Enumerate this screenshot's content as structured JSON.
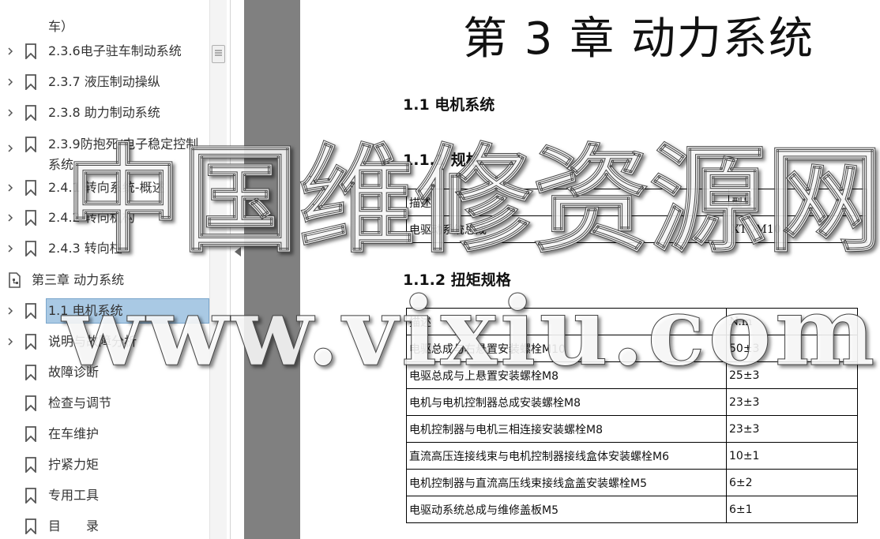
{
  "sidebar": {
    "items": [
      {
        "label": "车）",
        "kind": "partial"
      },
      {
        "label": "2.3.6电子驻车制动系统"
      },
      {
        "label": "2.3.7 液压制动操纵"
      },
      {
        "label": "2.3.8 助力制动系统"
      },
      {
        "label": "2.3.9防抱死/电子稳定控制系统"
      },
      {
        "label": "2.4.1 转向系统-概述"
      },
      {
        "label": "2.4.2 转向机构"
      },
      {
        "label": "2.4.3 转向柱"
      },
      {
        "label": "第三章 动力系统"
      },
      {
        "label": "1.1 电机系统"
      },
      {
        "label": "说明与故障分析"
      },
      {
        "label": "故障诊断"
      },
      {
        "label": "检查与调节"
      },
      {
        "label": "在车维护"
      },
      {
        "label": "拧紧力矩"
      },
      {
        "label": "专用工具"
      },
      {
        "label": "目　　录"
      }
    ]
  },
  "document": {
    "chapter_title": "第 3 章  动力系统",
    "section_1_1": "1.1  电机系统",
    "section_1_1_1": "1.1.1 规格",
    "spec_table": {
      "headers": [
        "描述",
        "型号"
      ],
      "rows": [
        [
          "电驱动系统总成",
          "XTDM10"
        ]
      ]
    },
    "section_1_1_2": "1.1.2 扭矩规格",
    "torque_table": {
      "headers": [
        "描述",
        "N.m"
      ],
      "rows": [
        [
          "电驱总成与右悬置安装螺栓M10",
          "50±3"
        ],
        [
          "电驱总成与上悬置安装螺栓M8",
          "25±3"
        ],
        [
          "电机与电机控制器总成安装螺栓M8",
          "23±3"
        ],
        [
          "电机控制器与电机三相连接安装螺栓M8",
          "23±3"
        ],
        [
          "直流高压连接线束与电机控制器接线盒体安装螺栓M6",
          "10±1"
        ],
        [
          "电机控制器与直流高压线束接线盒盖安装螺栓M5",
          "6±2"
        ],
        [
          "电驱动系统总成与维修盖板M5",
          "6±1"
        ]
      ]
    }
  },
  "watermark": {
    "line1": "中国维修资源网",
    "line2": "www.vixiu.com"
  },
  "colors": {
    "selection": "#a9c9e4",
    "gutter": "#808080",
    "bookmark_icon": "#555555"
  }
}
